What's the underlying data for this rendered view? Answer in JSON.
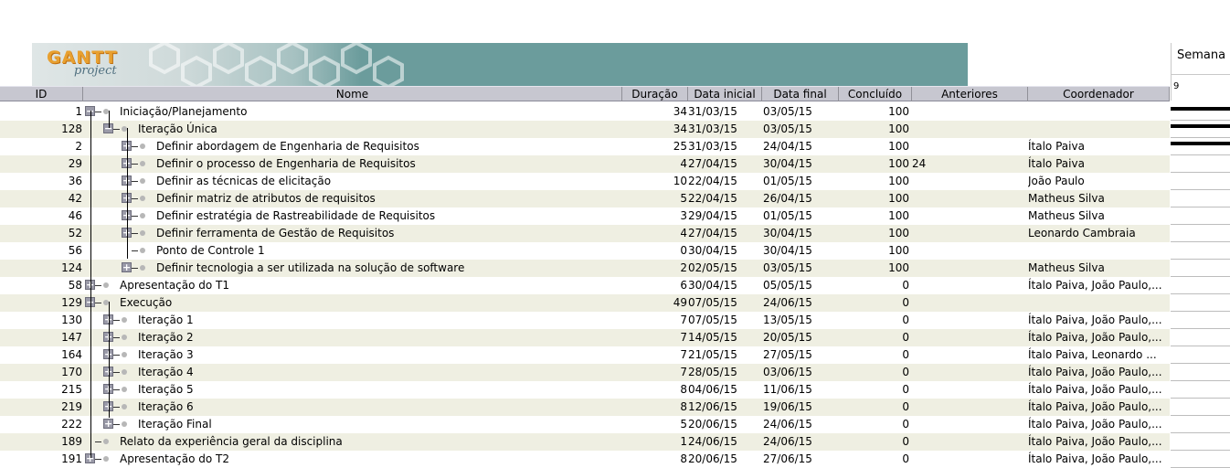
{
  "app": {
    "logo_text": "GANTT",
    "logo_sub": "project"
  },
  "timeline": {
    "header": "Semana",
    "week_number": "9"
  },
  "columns": {
    "id": "ID",
    "name": "Nome",
    "duration": "Duração",
    "start": "Data inicial",
    "end": "Data final",
    "completed": "Concluído",
    "predecessors": "Anteriores",
    "coordinator": "Coordenador"
  },
  "tasks": [
    {
      "id": "1",
      "name": "Iniciação/Planejamento",
      "duration": "34",
      "start": "31/03/15",
      "end": "03/05/15",
      "completed": "100",
      "predecessors": "",
      "coordinator": "",
      "level": 0,
      "toggle": "expanded"
    },
    {
      "id": "128",
      "name": "Iteração Única",
      "duration": "34",
      "start": "31/03/15",
      "end": "03/05/15",
      "completed": "100",
      "predecessors": "",
      "coordinator": "",
      "level": 1,
      "toggle": "expanded"
    },
    {
      "id": "2",
      "name": "Definir abordagem de Engenharia de Requisitos",
      "duration": "25",
      "start": "31/03/15",
      "end": "24/04/15",
      "completed": "100",
      "predecessors": "",
      "coordinator": "Ítalo Paiva",
      "level": 2,
      "toggle": "collapsed"
    },
    {
      "id": "29",
      "name": "Definir o processo de Engenharia de Requisitos",
      "duration": "4",
      "start": "27/04/15",
      "end": "30/04/15",
      "completed": "100",
      "predecessors": "24",
      "coordinator": "Ítalo Paiva",
      "level": 2,
      "toggle": "collapsed"
    },
    {
      "id": "36",
      "name": "Definir as técnicas de elicitação",
      "duration": "10",
      "start": "22/04/15",
      "end": "01/05/15",
      "completed": "100",
      "predecessors": "",
      "coordinator": "João Paulo",
      "level": 2,
      "toggle": "collapsed"
    },
    {
      "id": "42",
      "name": "Definir matriz de atributos de requisitos",
      "duration": "5",
      "start": "22/04/15",
      "end": "26/04/15",
      "completed": "100",
      "predecessors": "",
      "coordinator": "Matheus Silva",
      "level": 2,
      "toggle": "collapsed"
    },
    {
      "id": "46",
      "name": "Definir estratégia de Rastreabilidade de Requisitos",
      "duration": "3",
      "start": "29/04/15",
      "end": "01/05/15",
      "completed": "100",
      "predecessors": "",
      "coordinator": "Matheus Silva",
      "level": 2,
      "toggle": "collapsed"
    },
    {
      "id": "52",
      "name": "Definir ferramenta de Gestão de Requisitos",
      "duration": "4",
      "start": "27/04/15",
      "end": "30/04/15",
      "completed": "100",
      "predecessors": "",
      "coordinator": "Leonardo Cambraia",
      "level": 2,
      "toggle": "collapsed"
    },
    {
      "id": "56",
      "name": "Ponto de Controle 1",
      "duration": "0",
      "start": "30/04/15",
      "end": "30/04/15",
      "completed": "100",
      "predecessors": "",
      "coordinator": "",
      "level": 2,
      "toggle": "none"
    },
    {
      "id": "124",
      "name": "Definir tecnologia a ser utilizada na solução de software",
      "duration": "2",
      "start": "02/05/15",
      "end": "03/05/15",
      "completed": "100",
      "predecessors": "",
      "coordinator": "Matheus Silva",
      "level": 2,
      "toggle": "collapsed"
    },
    {
      "id": "58",
      "name": "Apresentação do T1",
      "duration": "6",
      "start": "30/04/15",
      "end": "05/05/15",
      "completed": "0",
      "predecessors": "",
      "coordinator": "Ítalo Paiva, João Paulo,...",
      "level": 0,
      "toggle": "collapsed"
    },
    {
      "id": "129",
      "name": "Execução",
      "duration": "49",
      "start": "07/05/15",
      "end": "24/06/15",
      "completed": "0",
      "predecessors": "",
      "coordinator": "",
      "level": 0,
      "toggle": "expanded"
    },
    {
      "id": "130",
      "name": "Iteração 1",
      "duration": "7",
      "start": "07/05/15",
      "end": "13/05/15",
      "completed": "0",
      "predecessors": "",
      "coordinator": "Ítalo Paiva, João Paulo,...",
      "level": 1,
      "toggle": "collapsed"
    },
    {
      "id": "147",
      "name": "Iteração 2",
      "duration": "7",
      "start": "14/05/15",
      "end": "20/05/15",
      "completed": "0",
      "predecessors": "",
      "coordinator": "Ítalo Paiva, João Paulo,...",
      "level": 1,
      "toggle": "collapsed"
    },
    {
      "id": "164",
      "name": "Iteração 3",
      "duration": "7",
      "start": "21/05/15",
      "end": "27/05/15",
      "completed": "0",
      "predecessors": "",
      "coordinator": "Ítalo Paiva, Leonardo ...",
      "level": 1,
      "toggle": "collapsed"
    },
    {
      "id": "170",
      "name": "Iteração 4",
      "duration": "7",
      "start": "28/05/15",
      "end": "03/06/15",
      "completed": "0",
      "predecessors": "",
      "coordinator": "Ítalo Paiva, João Paulo,...",
      "level": 1,
      "toggle": "collapsed"
    },
    {
      "id": "215",
      "name": "Iteração 5",
      "duration": "8",
      "start": "04/06/15",
      "end": "11/06/15",
      "completed": "0",
      "predecessors": "",
      "coordinator": "Ítalo Paiva, João Paulo,...",
      "level": 1,
      "toggle": "collapsed"
    },
    {
      "id": "219",
      "name": "Iteração 6",
      "duration": "8",
      "start": "12/06/15",
      "end": "19/06/15",
      "completed": "0",
      "predecessors": "",
      "coordinator": "Ítalo Paiva, João Paulo,...",
      "level": 1,
      "toggle": "collapsed"
    },
    {
      "id": "222",
      "name": "Iteração Final",
      "duration": "5",
      "start": "20/06/15",
      "end": "24/06/15",
      "completed": "0",
      "predecessors": "",
      "coordinator": "Ítalo Paiva, João Paulo,...",
      "level": 1,
      "toggle": "collapsed"
    },
    {
      "id": "189",
      "name": "Relato da experiência geral da disciplina",
      "duration": "1",
      "start": "24/06/15",
      "end": "24/06/15",
      "completed": "0",
      "predecessors": "",
      "coordinator": "Ítalo Paiva, João Paulo,...",
      "level": 0,
      "toggle": "none"
    },
    {
      "id": "191",
      "name": "Apresentação do T2",
      "duration": "8",
      "start": "20/06/15",
      "end": "27/06/15",
      "completed": "0",
      "predecessors": "",
      "coordinator": "Ítalo Paiva, João Paulo,...",
      "level": 0,
      "toggle": "collapsed"
    }
  ]
}
